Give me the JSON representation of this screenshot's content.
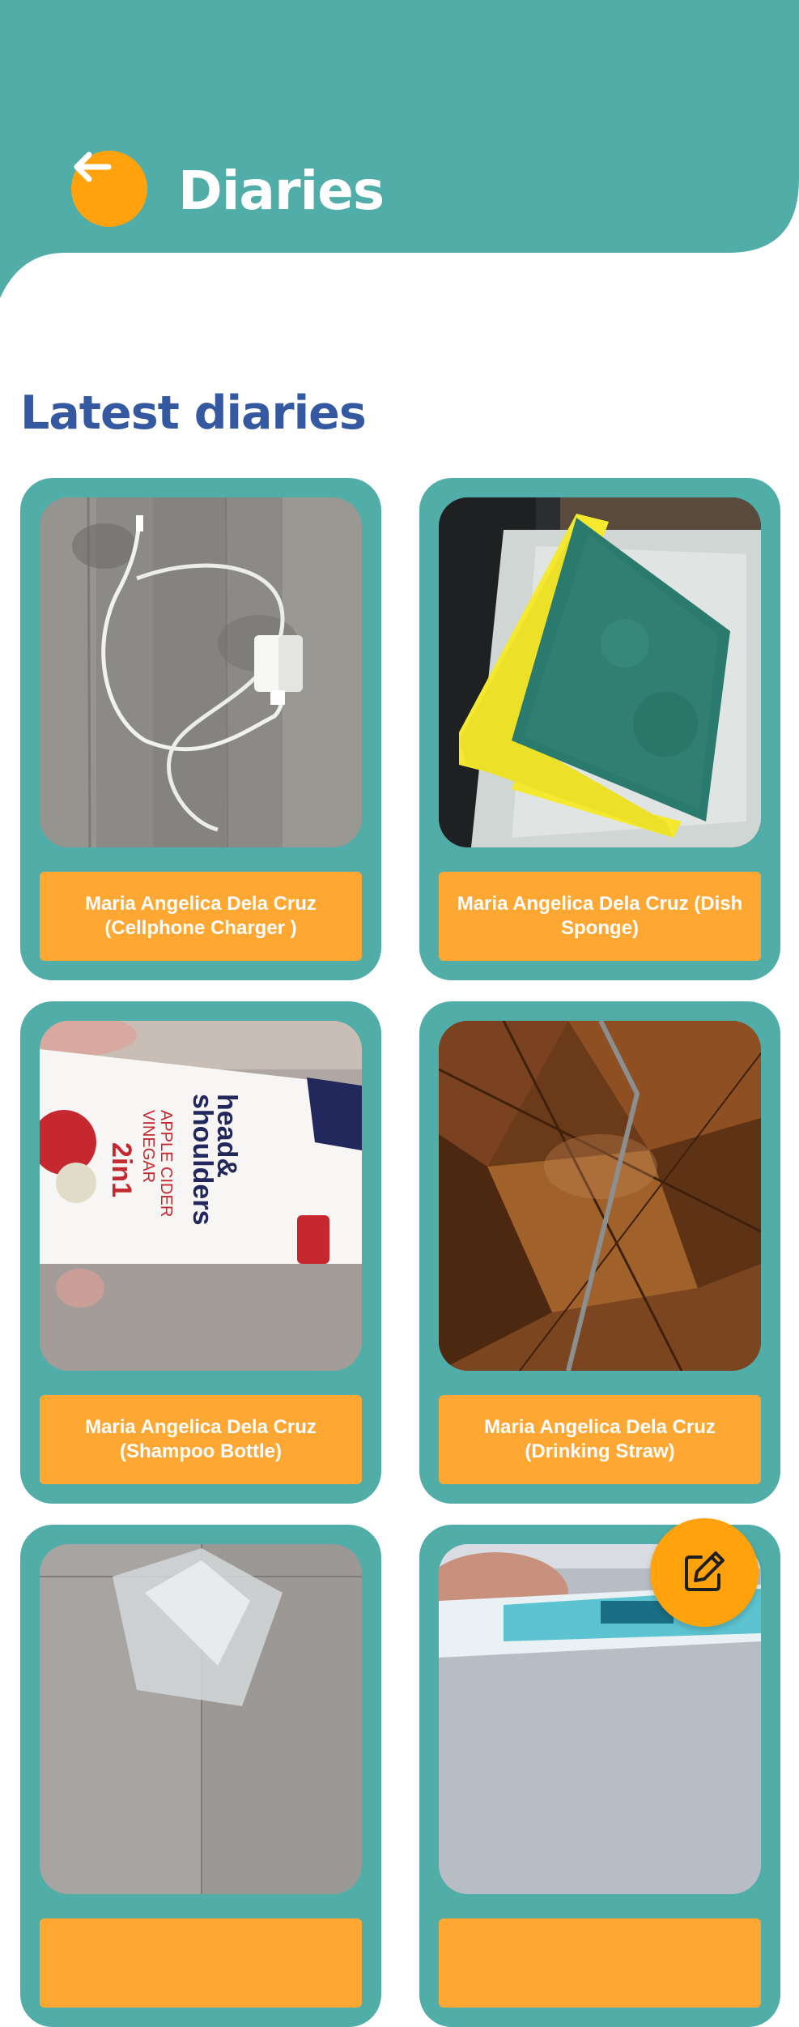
{
  "header": {
    "title": "Diaries",
    "back_icon": "arrow-left-icon",
    "color": "#50ADA7",
    "button_color": "#FFA20B"
  },
  "section": {
    "title": "Latest diaries"
  },
  "diaries": [
    {
      "label": "Maria Angelica Dela Cruz (Cellphone Charger )",
      "photo": "cellphone-charger-photo"
    },
    {
      "label": "Maria Angelica Dela Cruz (Dish Sponge)",
      "photo": "dish-sponge-photo"
    },
    {
      "label": "Maria Angelica Dela Cruz (Shampoo Bottle)",
      "photo": "shampoo-bottle-photo"
    },
    {
      "label": "Maria Angelica Dela Cruz (Drinking Straw)",
      "photo": "drinking-straw-photo"
    },
    {
      "label": "",
      "photo": "plastic-bag-photo"
    },
    {
      "label": "",
      "photo": "toothpaste-photo"
    }
  ],
  "fab": {
    "icon": "edit-icon"
  }
}
